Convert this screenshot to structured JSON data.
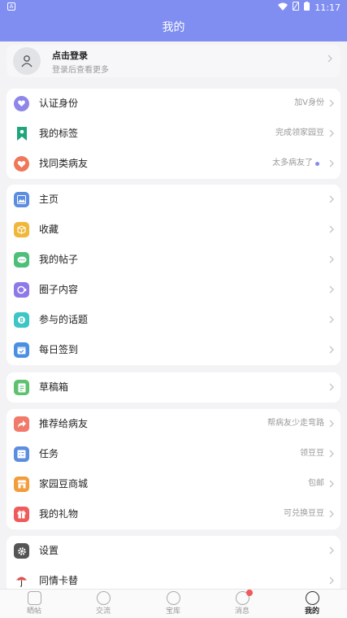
{
  "status_bar": {
    "time": "11:17"
  },
  "header": {
    "title": "我的"
  },
  "login": {
    "title": "点击登录",
    "subtitle": "登录后查看更多"
  },
  "groups": [
    {
      "items": [
        {
          "label": "认证身份",
          "hint": "加V身份",
          "icon": "shield-heart-icon",
          "color": "#8e86e8"
        },
        {
          "label": "我的标签",
          "hint": "完成领家园豆",
          "icon": "bookmark-icon",
          "color": "#20a57a"
        },
        {
          "label": "找同类病友",
          "hint": "太多病友了",
          "icon": "heart-icon",
          "color": "#f07758",
          "dot": true
        }
      ]
    },
    {
      "items": [
        {
          "label": "主页",
          "icon": "image-icon",
          "color": "#5d8de0"
        },
        {
          "label": "收藏",
          "icon": "gift-box-icon",
          "color": "#f0b73a"
        },
        {
          "label": "我的帖子",
          "icon": "chat-icon",
          "color": "#4dbf79"
        },
        {
          "label": "圈子内容",
          "icon": "circle-icon",
          "color": "#8f79e8"
        },
        {
          "label": "参与的话题",
          "icon": "topic-icon",
          "color": "#3cc6c6"
        },
        {
          "label": "每日签到",
          "icon": "calendar-icon",
          "color": "#4b8fe2"
        }
      ]
    },
    {
      "items": [
        {
          "label": "草稿箱",
          "icon": "draft-icon",
          "color": "#5fc170"
        }
      ]
    },
    {
      "items": [
        {
          "label": "推荐给病友",
          "hint": "帮病友少走弯路",
          "icon": "share-icon",
          "color": "#f27a6a"
        },
        {
          "label": "任务",
          "hint": "领豆豆",
          "icon": "task-icon",
          "color": "#5d8de0"
        },
        {
          "label": "家园豆商城",
          "hint": "包邮",
          "icon": "shop-icon",
          "color": "#f39c3b"
        },
        {
          "label": "我的礼物",
          "hint": "可兑换豆豆",
          "icon": "gift-icon",
          "color": "#ef5a5a"
        }
      ]
    },
    {
      "items": [
        {
          "label": "设置",
          "icon": "gear-icon",
          "color": "#555555"
        },
        {
          "label": "同情卡替",
          "icon": "umbrella-icon",
          "color": "#d9534f"
        }
      ]
    }
  ],
  "tabs": [
    {
      "label": "晒帖",
      "icon": "post-icon"
    },
    {
      "label": "交流",
      "icon": "chat-bubble-icon"
    },
    {
      "label": "宝库",
      "icon": "treasure-icon"
    },
    {
      "label": "消息",
      "icon": "message-icon",
      "badge": true
    },
    {
      "label": "我的",
      "icon": "face-icon",
      "active": true
    }
  ]
}
